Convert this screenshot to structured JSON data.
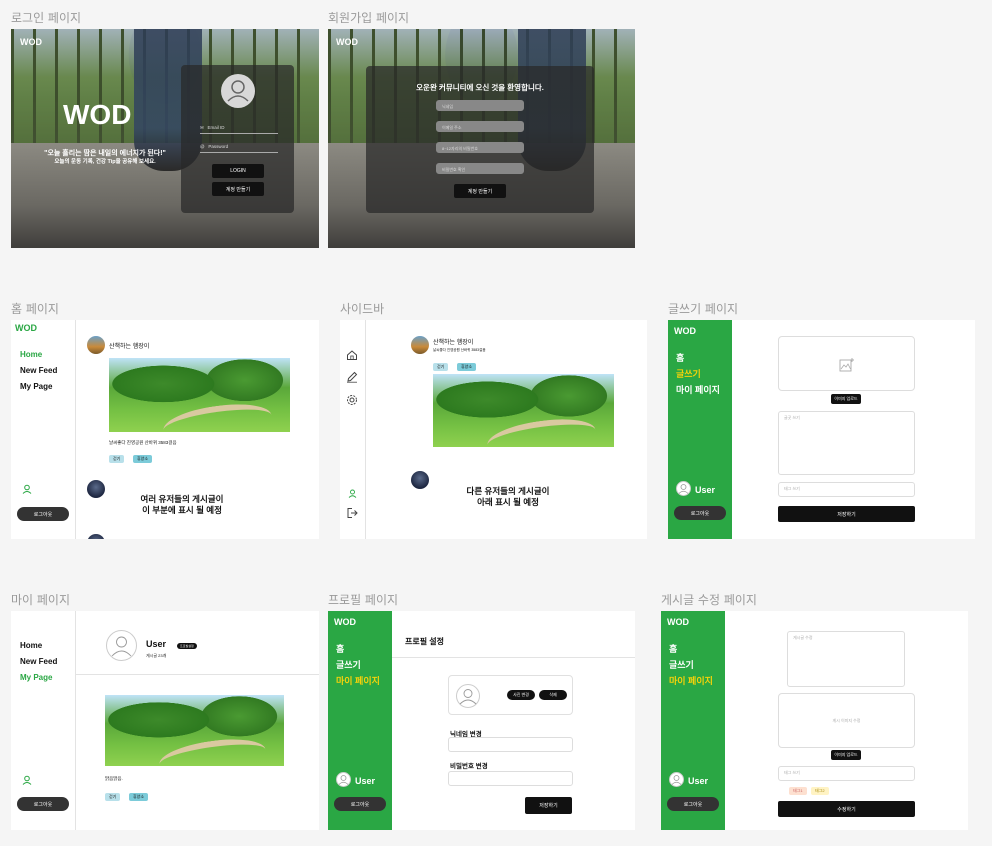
{
  "frames": {
    "login": {
      "label": "로그인 페이지",
      "logo": "WOD",
      "big_logo": "WOD",
      "quote": "\"오늘 흘리는 땀은 내일의 에너지가 된다!\"",
      "subquote": "오늘의 운동 기록, 건강 Tip을 공유해 보세요.",
      "email_placeholder": "Email ID",
      "password_placeholder": "Password",
      "login_button": "LOGIN",
      "signup_button": "계정 만들기"
    },
    "signup": {
      "label": "회원가입 페이지",
      "logo": "WOD",
      "title": "오운완 커뮤니티에 오신 것을 환영합니다.",
      "fields": [
        "닉네임",
        "이메일 주소",
        "8~12자리의 비밀번호",
        "비밀번호 확인"
      ],
      "submit_button": "계정 만들기"
    },
    "home": {
      "label": "홈 페이지",
      "logo": "WOD",
      "nav": [
        "Home",
        "New Feed",
        "My Page"
      ],
      "post_author": "산책하는 햄장이",
      "post_caption": "날씨좋다 진영공원 산바퀴 3583걸음",
      "tags": [
        "걷기",
        "휴양소"
      ],
      "placeholder_line1": "여러 유저들의 게시글이",
      "placeholder_line2": "이 부분에 표시 될 예정",
      "logout_button": "로그아웃"
    },
    "sidebar": {
      "label": "사이드바",
      "post_author": "산책하는 햄장이",
      "post_caption": "날씨좋다 진영공원 산바퀴 3583걸음",
      "tags": [
        "걷기",
        "휴양소"
      ],
      "placeholder_line1": "다른 유저들의 게시글이",
      "placeholder_line2": "아래 표시 될 예정"
    },
    "write": {
      "label": "글쓰기 페이지",
      "logo": "WOD",
      "nav": [
        "홈",
        "글쓰기",
        "마이 페이지"
      ],
      "upload_button": "이미지 업로드",
      "content_placeholder": "글곳 쓰기",
      "tag_placeholder": "태그 쓰기",
      "save_button": "저장하기",
      "user_name": "User",
      "logout_button": "로그아웃"
    },
    "mypage": {
      "label": "마이 페이지",
      "nav": [
        "Home",
        "New Feed",
        "My Page"
      ],
      "user_name": "User",
      "badge": "프로필설정",
      "post_count": "게시글 23개",
      "post_caption": "맑음맑음.",
      "tags": [
        "걷기",
        "휴양소"
      ],
      "logout_button": "로그아웃"
    },
    "profile": {
      "label": "프로필 페이지",
      "logo": "WOD",
      "nav": [
        "홈",
        "글쓰기",
        "마이 페이지"
      ],
      "title": "프로필 설정",
      "change_photo": "사진 변경",
      "delete_photo": "삭제",
      "nickname_label": "닉네임 변경",
      "password_label": "비밀번호 변경",
      "save_button": "저장하기",
      "user_name": "User",
      "logout_button": "로그아웃"
    },
    "edit": {
      "label": "게시글 수정 페이지",
      "logo": "WOD",
      "nav": [
        "홈",
        "글쓰기",
        "마이 페이지"
      ],
      "content_placeholder": "게시글 수정",
      "image_placeholder": "게시 이미지 수정",
      "upload_button": "이미지 업로드",
      "tag_placeholder": "태그 쓰기",
      "tags": [
        "태그1",
        "태그2"
      ],
      "submit_button": "수정하기",
      "user_name": "User",
      "logout_button": "로그아웃"
    }
  },
  "colors": {
    "brand_green": "#2aa744",
    "active_yellow": "#f5d20a",
    "dark": "#111111"
  }
}
